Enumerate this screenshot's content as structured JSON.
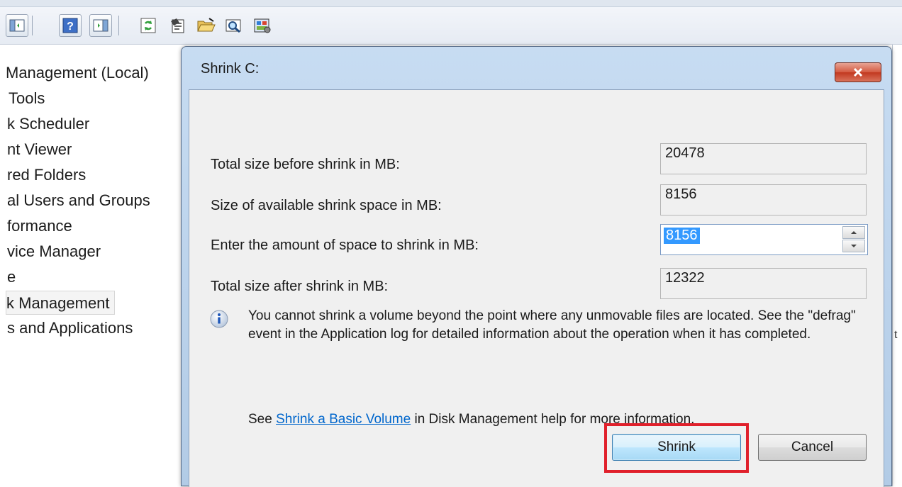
{
  "toolbar": {
    "icons": [
      "show-hide-console-tree-icon",
      "help-icon",
      "show-hide-action-pane-icon",
      "refresh-icon",
      "properties-icon",
      "open-folder-icon",
      "search-icon",
      "disk-management-icon"
    ]
  },
  "tree": {
    "items": [
      {
        "label": "Management (Local)"
      },
      {
        "label": "Tools"
      },
      {
        "label": "k Scheduler"
      },
      {
        "label": "nt Viewer"
      },
      {
        "label": "red Folders"
      },
      {
        "label": "al Users and Groups"
      },
      {
        "label": "formance"
      },
      {
        "label": "vice Manager"
      },
      {
        "label": "e"
      },
      {
        "label": "k Management"
      },
      {
        "label": "s and Applications"
      }
    ]
  },
  "dialog": {
    "title": "Shrink C:",
    "fields": [
      {
        "label": "Total size before shrink in MB:",
        "value": "20478"
      },
      {
        "label": "Size of available shrink space in MB:",
        "value": "8156"
      },
      {
        "label": "Enter the amount of space to shrink in MB:",
        "value": "8156"
      },
      {
        "label": "Total size after shrink in MB:",
        "value": "12322"
      }
    ],
    "info_text": "You cannot shrink a volume beyond the point where any unmovable files are located. See the \"defrag\" event in the Application log for detailed information about the operation when it has completed.",
    "help_prefix": "See ",
    "help_link": "Shrink a Basic Volume",
    "help_suffix": " in Disk Management help for more information.",
    "shrink_label": "Shrink",
    "cancel_label": "Cancel"
  },
  "right_pane": {
    "mark_1": "t"
  },
  "colors": {
    "highlight": "#e0202b",
    "selection": "#3399ff",
    "link": "#0066cc",
    "close": "#c2381f"
  }
}
